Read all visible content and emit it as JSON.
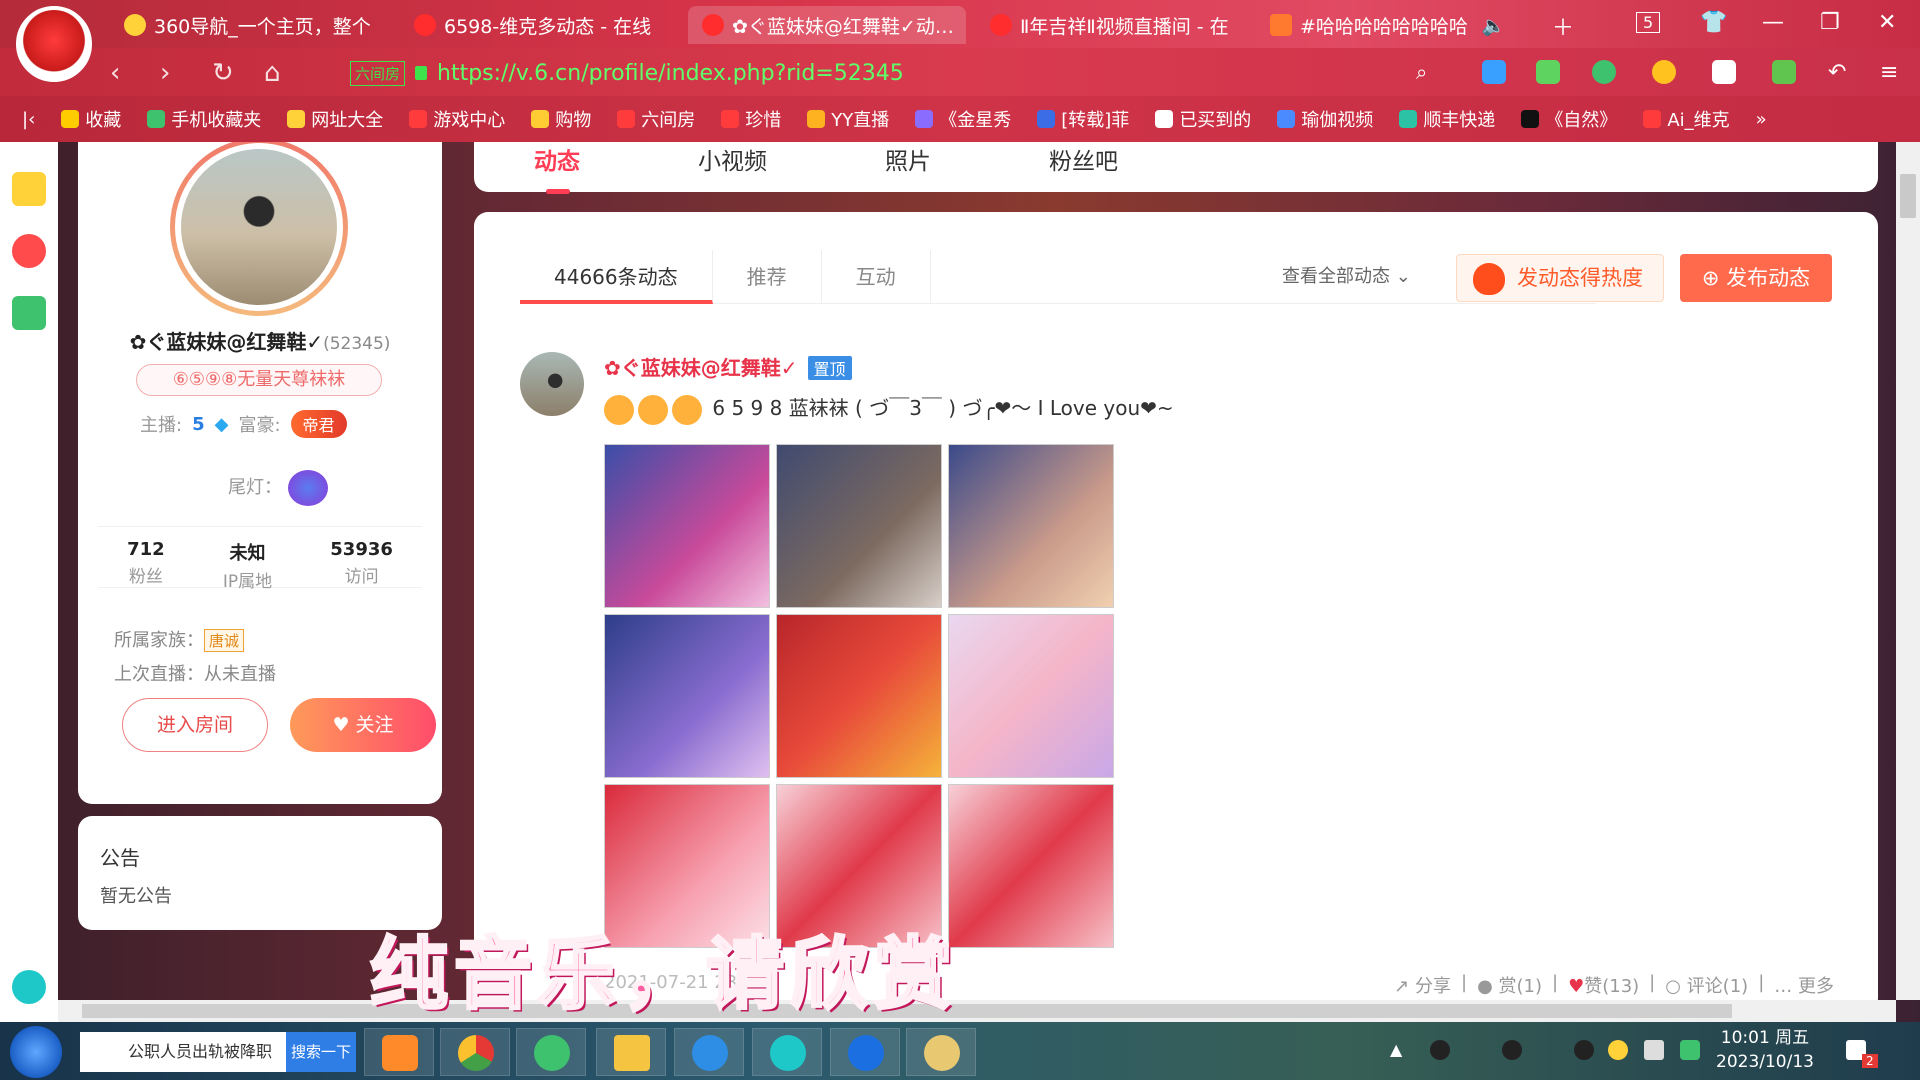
{
  "browser": {
    "tabs": [
      {
        "label": "360导航_一个主页，整个",
        "active": false
      },
      {
        "label": "6598-维克多动态 - 在线",
        "active": false
      },
      {
        "label": "✿ぐ蓝妹妹@红舞鞋✓动…",
        "active": true
      },
      {
        "label": "Ⅱ年吉祥Ⅱ视频直播间 - 在",
        "active": false
      },
      {
        "label": "#哈哈哈哈哈哈哈哈",
        "active": false
      }
    ],
    "tab_count": "5",
    "url": "https://v.6.cn/profile/index.php?rid=52345",
    "url_badge": "六间房",
    "bookmarks": [
      "收藏",
      "手机收藏夹",
      "网址大全",
      "游戏中心",
      "购物",
      "六间房",
      "珍惜",
      "YY直播",
      "《金星秀",
      "[转载]菲",
      "已买到的",
      "瑜伽视频",
      "顺丰快递",
      "《自然》",
      "Ai_维克"
    ]
  },
  "profile_nav": {
    "tabs": [
      "动态",
      "小视频",
      "照片",
      "粉丝吧"
    ],
    "active": "动态"
  },
  "profile": {
    "name": "✿ぐ蓝妹妹@红舞鞋✓",
    "rid": "(52345)",
    "tag": "⑥⑤⑨⑧无量天尊袜袜",
    "anchor_label": "主播:",
    "anchor_level": "5",
    "rich_label": "富豪:",
    "rich_title": "帝君",
    "taillight_label": "尾灯：",
    "stats": [
      {
        "value": "712",
        "label": "粉丝"
      },
      {
        "value": "未知",
        "label": "IP属地"
      },
      {
        "value": "53936",
        "label": "访问"
      }
    ],
    "family_label": "所属家族：",
    "family_value": "唐诚",
    "last_live_label": "上次直播：",
    "last_live_value": "从未直播",
    "enter_room": "进入房间",
    "follow": "关注"
  },
  "notice": {
    "title": "公告",
    "content": "暂无公告"
  },
  "feed": {
    "tabs": [
      "44666条动态",
      "推荐",
      "互动"
    ],
    "view_all": "查看全部动态",
    "hot_button": "发动态得热度",
    "post_button": "发布动态",
    "post": {
      "user": "✿ぐ蓝妹妹@红舞鞋✓",
      "pinned": "置顶",
      "text": "6  5  9  8  蓝袜袜  ( づ￣3￣ ) づ╭❤～ I Love you❤~",
      "date": "2021-07-21 23",
      "actions": [
        "分享",
        "赏(1)",
        "赞(13)",
        "评论(1)",
        "更多"
      ]
    }
  },
  "caption": "纯音乐，请欣赏",
  "taskbar": {
    "search_text": "公职人员出轨被降职",
    "search_button": "搜索一下",
    "time": "10:01 周五",
    "date": "2023/10/13",
    "notification_count": "2"
  },
  "colors": {
    "accent": "#ff3d55",
    "chrome": "#d8344a",
    "follow_gradient_start": "#ff9a5a",
    "follow_gradient_end": "#ff4d6a"
  }
}
